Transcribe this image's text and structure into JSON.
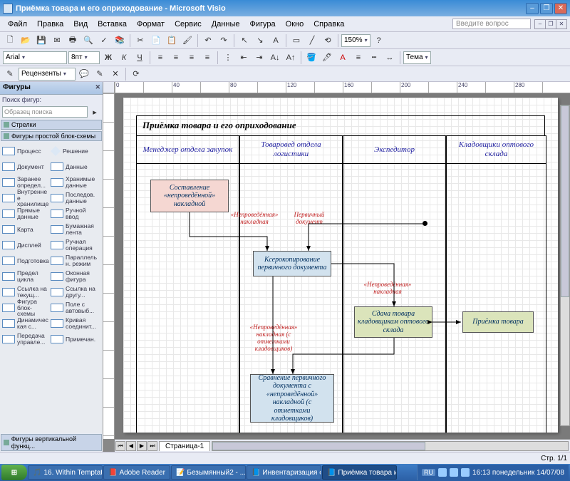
{
  "titlebar": {
    "title": "Приёмка товара и его оприходование - Microsoft Visio"
  },
  "menu": {
    "items": [
      "Файл",
      "Правка",
      "Вид",
      "Вставка",
      "Формат",
      "Сервис",
      "Данные",
      "Фигура",
      "Окно",
      "Справка"
    ],
    "help_placeholder": "Введите вопрос"
  },
  "toolbar2": {
    "font": "Arial",
    "size": "8пт",
    "zoom": "150%",
    "theme": "Тема"
  },
  "toolbar3": {
    "label": "Рецензенты"
  },
  "shapes_panel": {
    "title": "Фигуры",
    "search_label": "Поиск фигур:",
    "search_placeholder": "Образец поиска",
    "stencils": [
      "Стрелки",
      "Фигуры простой блок-схемы",
      "Фигуры вертикальной функц..."
    ],
    "items": [
      "Процесс",
      "Решение",
      "Документ",
      "Данные",
      "Заранее определ...",
      "Хранимые данные",
      "Внутреннее хранилище",
      "Последов. данные",
      "Прямые данные",
      "Ручной ввод",
      "Карта",
      "Бумажная лента",
      "Дисплей",
      "Ручная операция",
      "Подготовка",
      "Параллельн. режим",
      "Предел цикла",
      "Оконная фигура",
      "Ссылка на текущ...",
      "Ссылка на другу...",
      "Фигура блок-схемы",
      "Поле с автовыб...",
      "Динамическая с...",
      "Кривая соединит...",
      "Передача управле...",
      "Примечан."
    ]
  },
  "diagram": {
    "title": "Приёмка товара и его оприходование",
    "lanes": [
      "Менеджер отдела закупок",
      "Товаровед отдела логистики",
      "Экспедитор",
      "Кладовщики оптового склада"
    ],
    "box1": "Составление «непроведённой» накладной",
    "box2": "Ксерокопирование первичного документа",
    "box3": "Сдача товара кладовщикам оптового склада",
    "box4": "Приёмка товара",
    "box5": "Сравнение первичного документа с «непроведённой» накладной (с отметками кладовщиков)",
    "lbl1": "«Непроведённая» накладная",
    "lbl2": "Первичный документ",
    "lbl3": "«Непроведённая» накладная",
    "lbl4": "«Непроведённая» накладная (с отметками кладовщиков)"
  },
  "page_tabs": {
    "tab1": "Страница-1"
  },
  "statusbar": {
    "page": "Стр. 1/1"
  },
  "taskbar": {
    "items": [
      "16. Within Temptati...",
      "Adobe Reader",
      "Безымянный2 - ...",
      "Инвентаризация о...",
      "Приёмка товара и..."
    ],
    "lang": "RU",
    "time": "16:13",
    "date": "понедельник 14/07/08"
  }
}
